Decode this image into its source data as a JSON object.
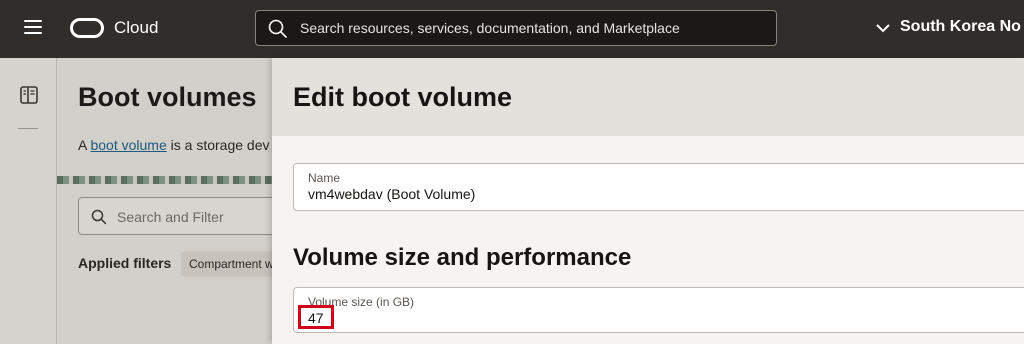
{
  "header": {
    "brand": "Cloud",
    "search_placeholder": "Search resources, services, documentation, and Marketplace",
    "region": "South Korea No"
  },
  "background_page": {
    "title": "Boot volumes",
    "description_prefix": "A ",
    "description_link": "boot volume",
    "description_suffix": " is a storage dev",
    "search_placeholder": "Search and Filter",
    "applied_filters_label": "Applied filters",
    "filter_chip": "Compartment w"
  },
  "panel": {
    "title": "Edit boot volume",
    "name_field": {
      "label": "Name",
      "value": "vm4webdav (Boot Volume)"
    },
    "section_title": "Volume size and performance",
    "size_field": {
      "label": "Volume size (in GB)",
      "value": "47"
    }
  },
  "colors": {
    "topbar": "#312d2a",
    "highlight": "#d0021b",
    "link": "#1c5a7d"
  }
}
